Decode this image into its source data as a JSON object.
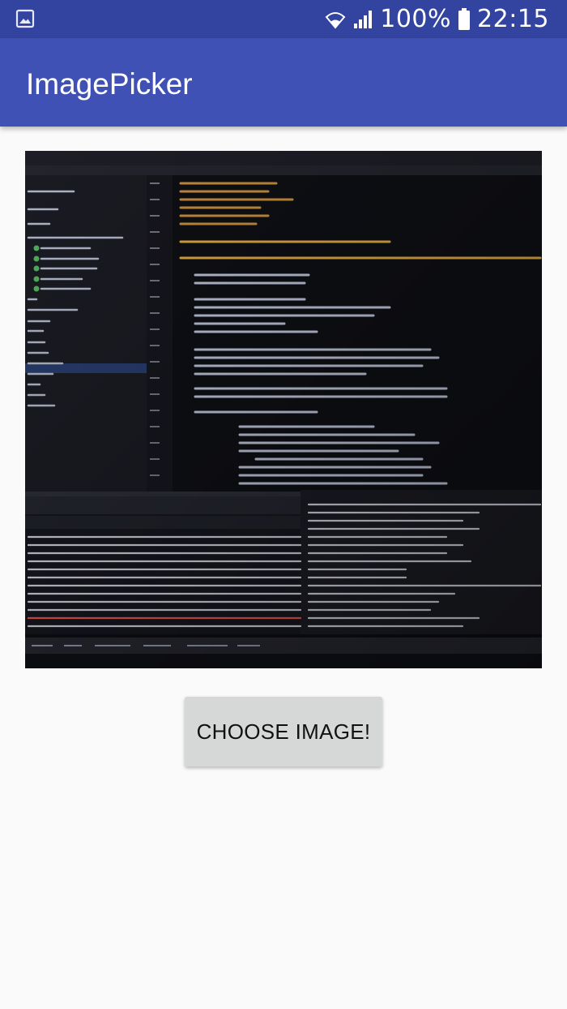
{
  "status_bar": {
    "battery_text": "100%",
    "time": "22:15",
    "icons": [
      "gallery-icon",
      "wifi-icon",
      "signal-icon",
      "battery-icon"
    ]
  },
  "app_bar": {
    "title": "ImagePicker",
    "color": "#3f51b5"
  },
  "image_view": {
    "description_icon": "photo-of-code-editor-screen"
  },
  "actions": {
    "choose_label": "CHOOSE IMAGE!"
  },
  "colors": {
    "status_bar": "#3343a0",
    "background": "#fafafa",
    "button": "#d6d7d7"
  }
}
